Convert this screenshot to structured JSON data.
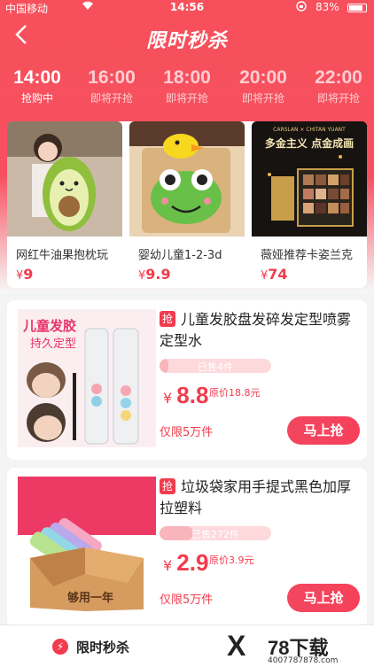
{
  "status_bar": {
    "carrier": "中国移动",
    "time": "14:56",
    "battery": "83%"
  },
  "header": {
    "title": "限时秒杀"
  },
  "time_tabs": [
    {
      "time": "14:00",
      "status": "抢购中",
      "active": true
    },
    {
      "time": "16:00",
      "status": "即将开抢",
      "active": false
    },
    {
      "time": "18:00",
      "status": "即将开抢",
      "active": false
    },
    {
      "time": "20:00",
      "status": "即将开抢",
      "active": false
    },
    {
      "time": "22:00",
      "status": "即将开抢",
      "active": false
    }
  ],
  "featured": [
    {
      "name": "网红牛油果抱枕玩",
      "currency": "¥",
      "price": "9"
    },
    {
      "name": "婴幼儿童1-2-3d",
      "currency": "¥",
      "price": "9.9"
    },
    {
      "name": "薇娅推荐卡姿兰克",
      "currency": "¥",
      "price": "74"
    }
  ],
  "featured_images": {
    "img3_line1": "多金主义 点金成画",
    "img3_top": "CARSLAN × CHITAN YUANT"
  },
  "products": [
    {
      "tag": "抢",
      "title": "儿童发胶盘发碎发定型喷雾定型水",
      "sold": "已售4件",
      "sold_fraction": 0.08,
      "currency": "¥",
      "price": "8.8",
      "original": "原价18.8元",
      "limit": "仅限5万件",
      "buy": "马上抢",
      "image_text_1": "儿童发胶",
      "image_text_2": "持久定型"
    },
    {
      "tag": "抢",
      "title": "垃圾袋家用手提式黑色加厚拉塑料",
      "sold": "已售272件",
      "sold_fraction": 0.3,
      "currency": "¥",
      "price": "2.9",
      "original": "原价3.9元",
      "limit": "仅限5万件",
      "buy": "马上抢",
      "image_text_1": "够用一年"
    }
  ],
  "bottom_bar": {
    "label": "限时秒杀"
  },
  "watermark": {
    "brand": "78下载",
    "url": "4007787878.com"
  },
  "colors": {
    "accent": "#f23b4d",
    "header": "#f7505c"
  }
}
